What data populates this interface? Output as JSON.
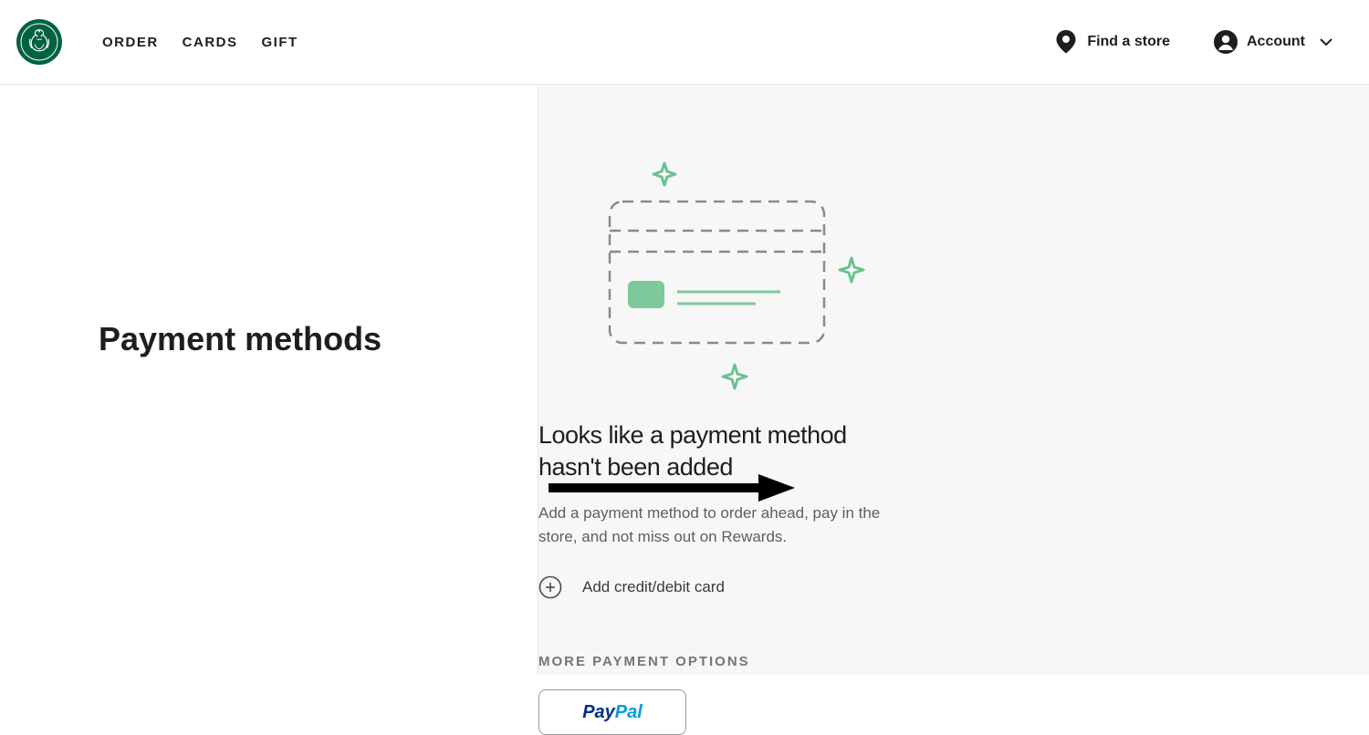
{
  "nav": {
    "order": "ORDER",
    "cards": "CARDS",
    "gift": "GIFT"
  },
  "header": {
    "find_store": "Find a store",
    "account": "Account"
  },
  "page": {
    "title": "Payment methods",
    "empty_title": "Looks like a payment method hasn't been added",
    "empty_desc": "Add a payment method to order ahead, pay in the store, and not miss out on Rewards.",
    "add_card_label": "Add credit/debit card",
    "more_options": "MORE PAYMENT OPTIONS",
    "paypal_pay": "Pay",
    "paypal_pal": "Pal"
  }
}
